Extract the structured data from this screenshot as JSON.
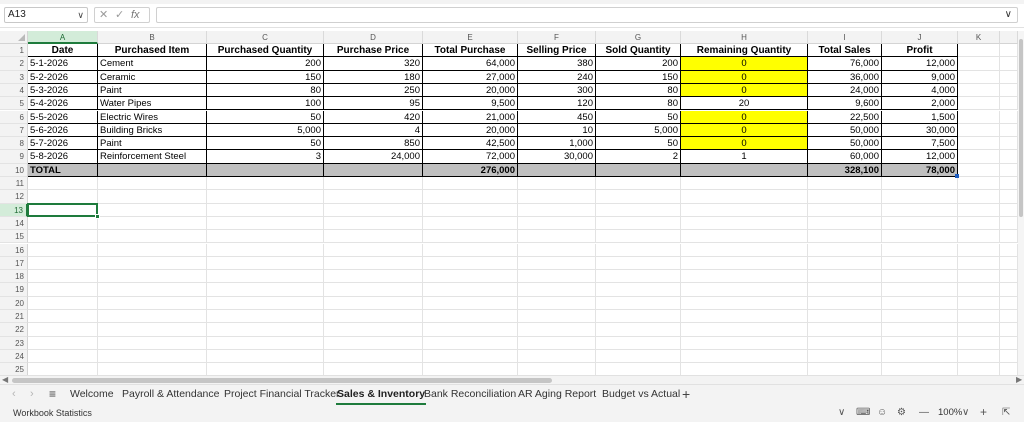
{
  "formula_bar": {
    "name_box": "A13",
    "fx_label": "fx"
  },
  "columns": [
    "A",
    "B",
    "C",
    "D",
    "E",
    "F",
    "G",
    "H",
    "I",
    "J",
    "K"
  ],
  "rows": [
    "1",
    "2",
    "3",
    "4",
    "5",
    "6",
    "7",
    "8",
    "9",
    "10",
    "11",
    "12",
    "13",
    "14",
    "15",
    "16",
    "17",
    "18",
    "19",
    "20",
    "21",
    "22",
    "23",
    "24",
    "25"
  ],
  "table": {
    "headers": [
      "Date",
      "Purchased Item",
      "Purchased Quantity",
      "Purchase Price",
      "Total Purchase",
      "Selling Price",
      "Sold Quantity",
      "Remaining Quantity",
      "Total Sales",
      "Profit"
    ],
    "rows": [
      [
        "5-1-2026",
        "Cement",
        "200",
        "320",
        "64,000",
        "380",
        "200",
        "0",
        "76,000",
        "12,000"
      ],
      [
        "5-2-2026",
        "Ceramic",
        "150",
        "180",
        "27,000",
        "240",
        "150",
        "0",
        "36,000",
        "9,000"
      ],
      [
        "5-3-2026",
        "Paint",
        "80",
        "250",
        "20,000",
        "300",
        "80",
        "0",
        "24,000",
        "4,000"
      ],
      [
        "5-4-2026",
        "Water Pipes",
        "100",
        "95",
        "9,500",
        "120",
        "80",
        "20",
        "9,600",
        "2,000"
      ],
      [
        "5-5-2026",
        "Electric Wires",
        "50",
        "420",
        "21,000",
        "450",
        "50",
        "0",
        "22,500",
        "1,500"
      ],
      [
        "5-6-2026",
        "Building Bricks",
        "5,000",
        "4",
        "20,000",
        "10",
        "5,000",
        "0",
        "50,000",
        "30,000"
      ],
      [
        "5-7-2026",
        "Paint",
        "50",
        "850",
        "42,500",
        "1,000",
        "50",
        "0",
        "50,000",
        "7,500"
      ],
      [
        "5-8-2026",
        "Reinforcement Steel",
        "3",
        "24,000",
        "72,000",
        "30,000",
        "2",
        "1",
        "60,000",
        "12,000"
      ]
    ],
    "total_row": [
      "TOTAL",
      "",
      "",
      "",
      "276,000",
      "",
      "",
      "",
      "328,100",
      "78,000"
    ]
  },
  "colors": {
    "highlight": "#ffff00",
    "total_fill": "#c0c0c0",
    "accent": "#1e7b3c"
  },
  "sheet_tabs": [
    {
      "label": "Welcome",
      "active": false
    },
    {
      "label": "Payroll & Attendance",
      "active": false
    },
    {
      "label": "Project Financial Tracker",
      "active": false
    },
    {
      "label": "Sales & Inventory",
      "active": true
    },
    {
      "label": "Bank Reconciliation",
      "active": false
    },
    {
      "label": "AR Aging Report",
      "active": false
    },
    {
      "label": "Budget vs Actual",
      "active": false
    }
  ],
  "status_bar": {
    "left_text": "Workbook Statistics",
    "zoom": "100%"
  }
}
